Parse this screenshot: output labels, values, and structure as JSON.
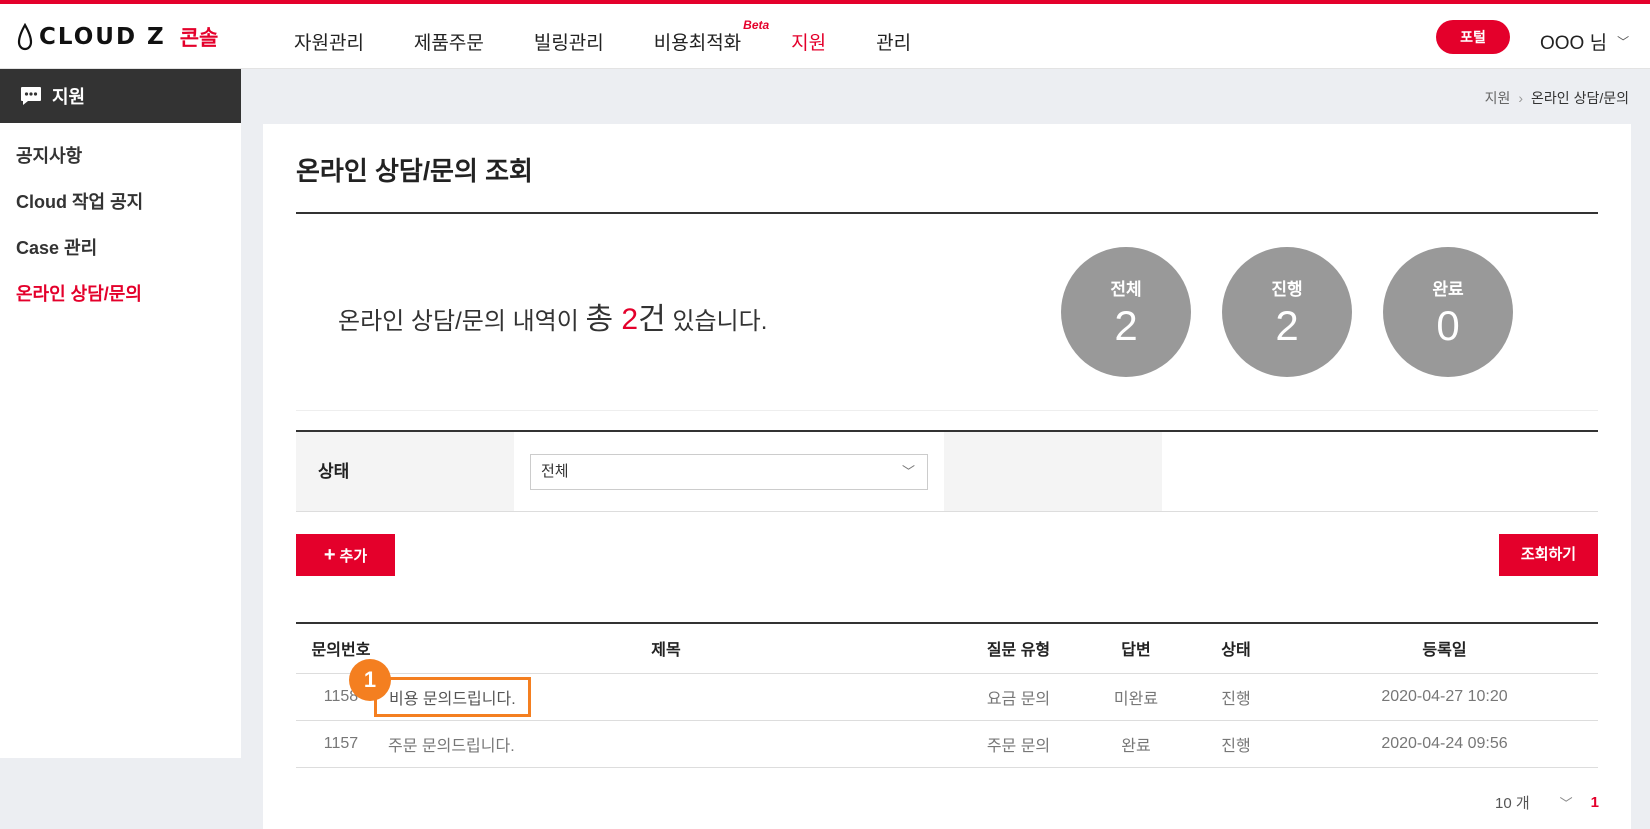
{
  "header": {
    "logo_text": "CLOUD Z",
    "logo_sub": "콘솔",
    "nav": [
      "자원관리",
      "제품주문",
      "빌링관리",
      "비용최적화",
      "지원",
      "관리"
    ],
    "beta_label": "Beta",
    "portal_label": "포털",
    "user_label": "OOO 님"
  },
  "sidebar": {
    "title": "지원",
    "items": [
      "공지사항",
      "Cloud 작업 공지",
      "Case 관리",
      "온라인 상담/문의"
    ]
  },
  "breadcrumb": {
    "parent": "지원",
    "current": "온라인 상담/문의"
  },
  "page": {
    "title": "온라인 상담/문의 조회",
    "summary_prefix": "온라인 상담/문의 내역이 ",
    "summary_total_word": "총 ",
    "summary_count": "2",
    "summary_unit": "건",
    "summary_suffix": " 있습니다.",
    "stats": [
      {
        "label": "전체",
        "value": "2"
      },
      {
        "label": "진행",
        "value": "2"
      },
      {
        "label": "완료",
        "value": "0"
      }
    ]
  },
  "filter": {
    "label": "상태",
    "selected": "전체"
  },
  "buttons": {
    "add": "추가",
    "search": "조회하기"
  },
  "table": {
    "headers": [
      "문의번호",
      "제목",
      "질문 유형",
      "답변",
      "상태",
      "등록일"
    ],
    "rows": [
      {
        "id": "1158",
        "title": "비용 문의드립니다.",
        "type": "요금 문의",
        "answer": "미완료",
        "status": "진행",
        "date": "2020-04-27 10:20"
      },
      {
        "id": "1157",
        "title": "주문 문의드립니다.",
        "type": "주문 문의",
        "answer": "완료",
        "status": "진행",
        "date": "2020-04-24 09:56"
      }
    ]
  },
  "pagination": {
    "page_size": "10 개",
    "current_page": "1"
  },
  "annotation": {
    "marker": "1"
  },
  "colors": {
    "accent": "#e4002b",
    "highlight": "#f47f20",
    "circle": "#999999"
  }
}
